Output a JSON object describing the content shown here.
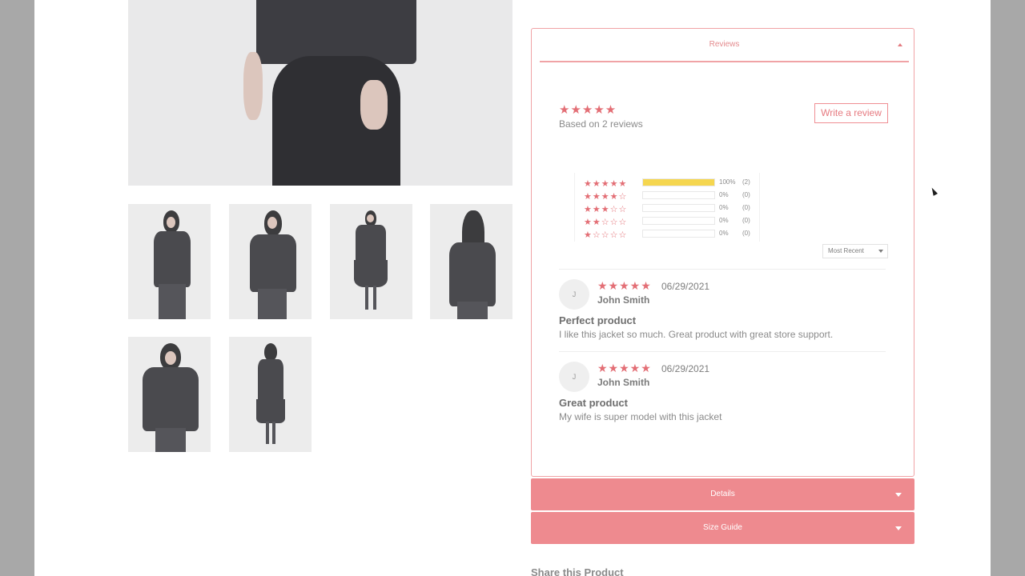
{
  "reviews": {
    "title": "Reviews",
    "summary_stars": "★★★★★",
    "based_on": "Based on 2 reviews",
    "write_review_label": "Write a review",
    "histogram": [
      {
        "stars": "★★★★★",
        "percent": "100%",
        "count": "(2)",
        "fill": 1.0
      },
      {
        "stars": "★★★★☆",
        "percent": "0%",
        "count": "(0)",
        "fill": 0
      },
      {
        "stars": "★★★☆☆",
        "percent": "0%",
        "count": "(0)",
        "fill": 0
      },
      {
        "stars": "★★☆☆☆",
        "percent": "0%",
        "count": "(0)",
        "fill": 0
      },
      {
        "stars": "★☆☆☆☆",
        "percent": "0%",
        "count": "(0)",
        "fill": 0
      }
    ],
    "sort_selected": "Most Recent",
    "items": [
      {
        "initial": "J",
        "stars": "★★★★★",
        "date": "06/29/2021",
        "author": "John Smith",
        "title": "Perfect product",
        "body": "I like this jacket so much. Great product with great store support."
      },
      {
        "initial": "J",
        "stars": "★★★★★",
        "date": "06/29/2021",
        "author": "John Smith",
        "title": "Great product",
        "body": "My wife is super model with this jacket"
      }
    ]
  },
  "accordions": {
    "details_label": "Details",
    "size_guide_label": "Size Guide"
  },
  "share_label": "Share this Product",
  "colors": {
    "accent": "#ee8a8f",
    "star": "#e36e75",
    "bar_fill": "#f5d64f"
  },
  "icons": {
    "caret_up": "caret-up-icon",
    "caret_down": "caret-down-icon"
  }
}
